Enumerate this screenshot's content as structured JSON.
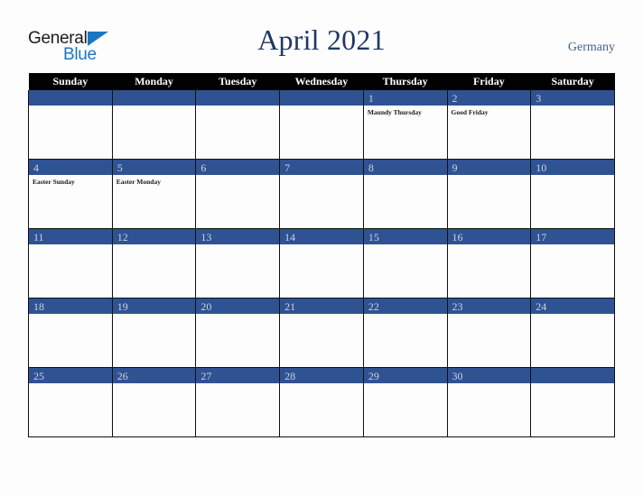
{
  "brand": {
    "name_part1": "General",
    "name_part2": "Blue",
    "triangle_icon": "triangle-right-icon",
    "color_dark": "#1b1b1b",
    "color_blue": "#1b76c4"
  },
  "header": {
    "title": "April 2021",
    "title_color": "#203864",
    "country": "Germany",
    "country_color": "#46608e"
  },
  "calendar": {
    "month": "April",
    "year": "2021",
    "weekday_headers": [
      "Sunday",
      "Monday",
      "Tuesday",
      "Wednesday",
      "Thursday",
      "Friday",
      "Saturday"
    ],
    "header_bg": "#010101",
    "header_text_color": "#ffffff",
    "daybar_bg": "#2f5293",
    "daynum_color": "#ccd2e2",
    "cell_bg": "#fdfdfd",
    "grid_line_color": "#111111",
    "weeks": [
      [
        {
          "day": "",
          "events": []
        },
        {
          "day": "",
          "events": []
        },
        {
          "day": "",
          "events": []
        },
        {
          "day": "",
          "events": []
        },
        {
          "day": "1",
          "events": [
            "Maundy Thursday"
          ]
        },
        {
          "day": "2",
          "events": [
            "Good Friday"
          ]
        },
        {
          "day": "3",
          "events": []
        }
      ],
      [
        {
          "day": "4",
          "events": [
            "Easter Sunday"
          ]
        },
        {
          "day": "5",
          "events": [
            "Easter Monday"
          ]
        },
        {
          "day": "6",
          "events": []
        },
        {
          "day": "7",
          "events": []
        },
        {
          "day": "8",
          "events": []
        },
        {
          "day": "9",
          "events": []
        },
        {
          "day": "10",
          "events": []
        }
      ],
      [
        {
          "day": "11",
          "events": []
        },
        {
          "day": "12",
          "events": []
        },
        {
          "day": "13",
          "events": []
        },
        {
          "day": "14",
          "events": []
        },
        {
          "day": "15",
          "events": []
        },
        {
          "day": "16",
          "events": []
        },
        {
          "day": "17",
          "events": []
        }
      ],
      [
        {
          "day": "18",
          "events": []
        },
        {
          "day": "19",
          "events": []
        },
        {
          "day": "20",
          "events": []
        },
        {
          "day": "21",
          "events": []
        },
        {
          "day": "22",
          "events": []
        },
        {
          "day": "23",
          "events": []
        },
        {
          "day": "24",
          "events": []
        }
      ],
      [
        {
          "day": "25",
          "events": []
        },
        {
          "day": "26",
          "events": []
        },
        {
          "day": "27",
          "events": []
        },
        {
          "day": "28",
          "events": []
        },
        {
          "day": "29",
          "events": []
        },
        {
          "day": "30",
          "events": []
        },
        {
          "day": "",
          "events": []
        }
      ]
    ]
  }
}
